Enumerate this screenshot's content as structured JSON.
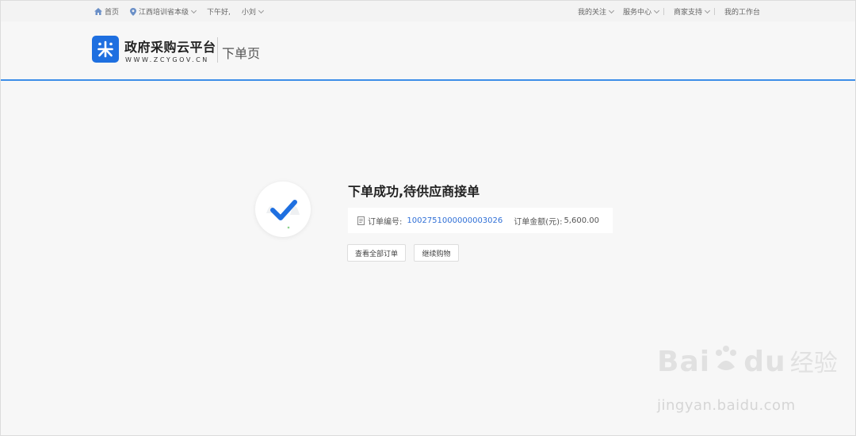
{
  "topbar": {
    "home": "首页",
    "location": "江西培训省本级",
    "greeting": "下午好,",
    "user": "小刘",
    "my_follow": "我的关注",
    "service_center": "服务中心",
    "merchant_support": "商家支持",
    "my_workbench": "我的工作台"
  },
  "header": {
    "brand_title": "政府采购云平台",
    "brand_url": "WWW.ZCYGOV.CN",
    "page_name": "下单页"
  },
  "success": {
    "title": "下单成功,待供应商接单",
    "order_no_label": "订单编号:",
    "order_no": "1002751000000003026",
    "amount_label": "订单金额(元):",
    "amount": "5,600.00",
    "btn_view_all": "查看全部订单",
    "btn_continue": "继续购物"
  },
  "watermark": {
    "brand": "Bai",
    "brand2": "du",
    "cn": "经验",
    "url": "jingyan.baidu.com"
  },
  "colors": {
    "accent": "#1e6fe0",
    "link": "#2f6fd6",
    "divider": "#3d8ee8"
  }
}
